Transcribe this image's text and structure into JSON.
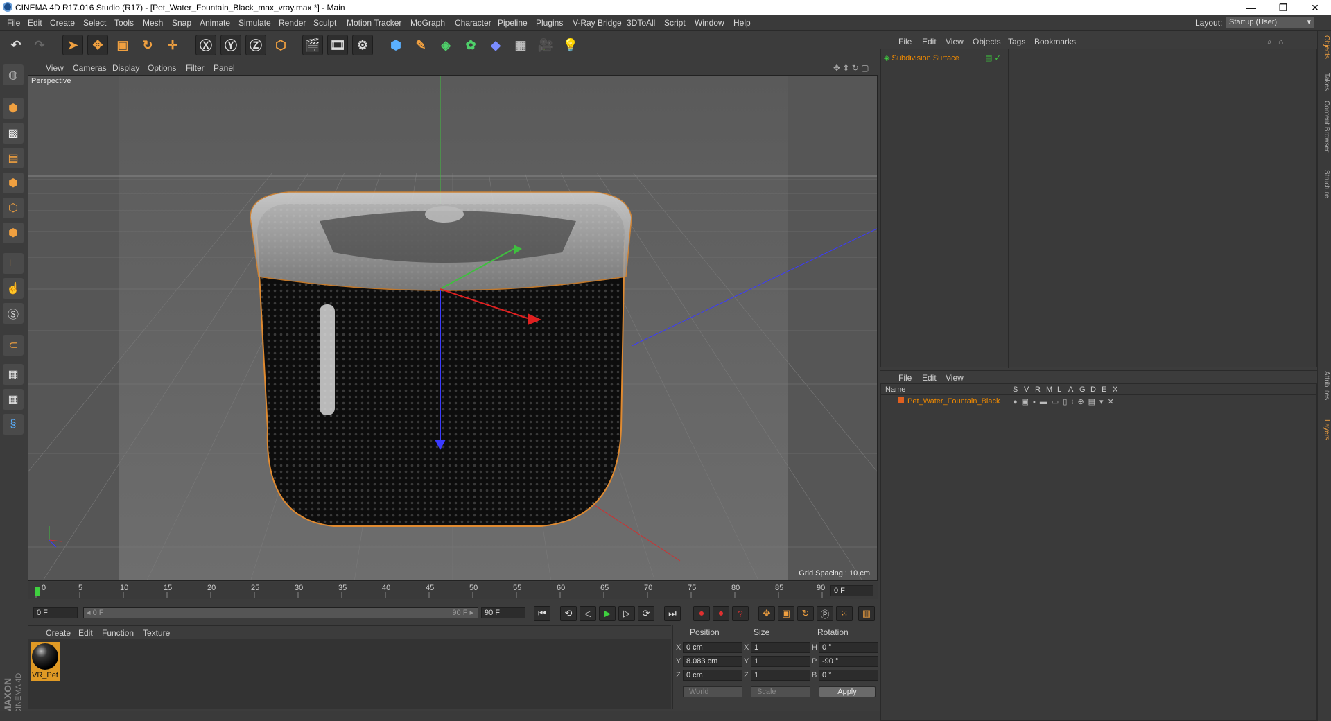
{
  "window": {
    "title": "CINEMA 4D R17.016 Studio (R17) - [Pet_Water_Fountain_Black_max_vray.max *] - Main",
    "minimize": "—",
    "restore": "❐",
    "close": "✕"
  },
  "menu": [
    "File",
    "Edit",
    "Create",
    "Select",
    "Tools",
    "Mesh",
    "Snap",
    "Animate",
    "Simulate",
    "Render",
    "Sculpt",
    "Motion Tracker",
    "MoGraph",
    "Character",
    "Pipeline",
    "Plugins",
    "V-Ray Bridge",
    "3DToAll",
    "Script",
    "Window",
    "Help"
  ],
  "layout": {
    "label": "Layout:",
    "value": "Startup (User)"
  },
  "viewport_menu": [
    "View",
    "Cameras",
    "Display",
    "Options",
    "Filter",
    "Panel"
  ],
  "viewport": {
    "label": "Perspective",
    "grid_spacing": "Grid Spacing : 10 cm"
  },
  "timeline": {
    "ticks": [
      "0",
      "5",
      "10",
      "15",
      "20",
      "25",
      "30",
      "35",
      "40",
      "45",
      "50",
      "55",
      "60",
      "65",
      "70",
      "75",
      "80",
      "85",
      "90"
    ],
    "current_frame": "0 F",
    "start_field": "0 F",
    "range_start": "◂ 0 F",
    "range_end": "90 F ▸",
    "end_field": "90 F"
  },
  "material_menu": [
    "Create",
    "Edit",
    "Function",
    "Texture"
  ],
  "material": {
    "name": "VR_Pet"
  },
  "brand": {
    "line1": "MAXON",
    "line2": "CINEMA 4D"
  },
  "coordinates": {
    "headers": {
      "position": "Position",
      "size": "Size",
      "rotation": "Rotation"
    },
    "rows": [
      {
        "axis": "X",
        "pos": "0 cm",
        "saxis": "X",
        "size": "1",
        "raxis": "H",
        "rot": "0 °"
      },
      {
        "axis": "Y",
        "pos": "8.083 cm",
        "saxis": "Y",
        "size": "1",
        "raxis": "P",
        "rot": "-90 °"
      },
      {
        "axis": "Z",
        "pos": "0 cm",
        "saxis": "Z",
        "size": "1",
        "raxis": "B",
        "rot": "0 °"
      }
    ],
    "mode1": "World",
    "mode2": "Scale",
    "apply": "Apply"
  },
  "object_menu": [
    "File",
    "Edit",
    "View",
    "Objects",
    "Tags",
    "Bookmarks"
  ],
  "objects": [
    {
      "name": "Subdivision Surface"
    }
  ],
  "layer_menu": [
    "File",
    "Edit",
    "View"
  ],
  "layers": {
    "name_header": "Name",
    "flags": [
      "S",
      "V",
      "R",
      "M",
      "L",
      "A",
      "G",
      "D",
      "E",
      "X"
    ],
    "rows": [
      {
        "name": "Pet_Water_Fountain_Black"
      }
    ]
  },
  "right_tabs": [
    "Objects",
    "Takes",
    "Content Browser",
    "Structure"
  ],
  "right_tabs_lower": [
    "Attributes",
    "Layers"
  ],
  "colors": {
    "accent": "#f08a00",
    "background": "#3c3c3c",
    "viewport": "#5f5f5f"
  }
}
